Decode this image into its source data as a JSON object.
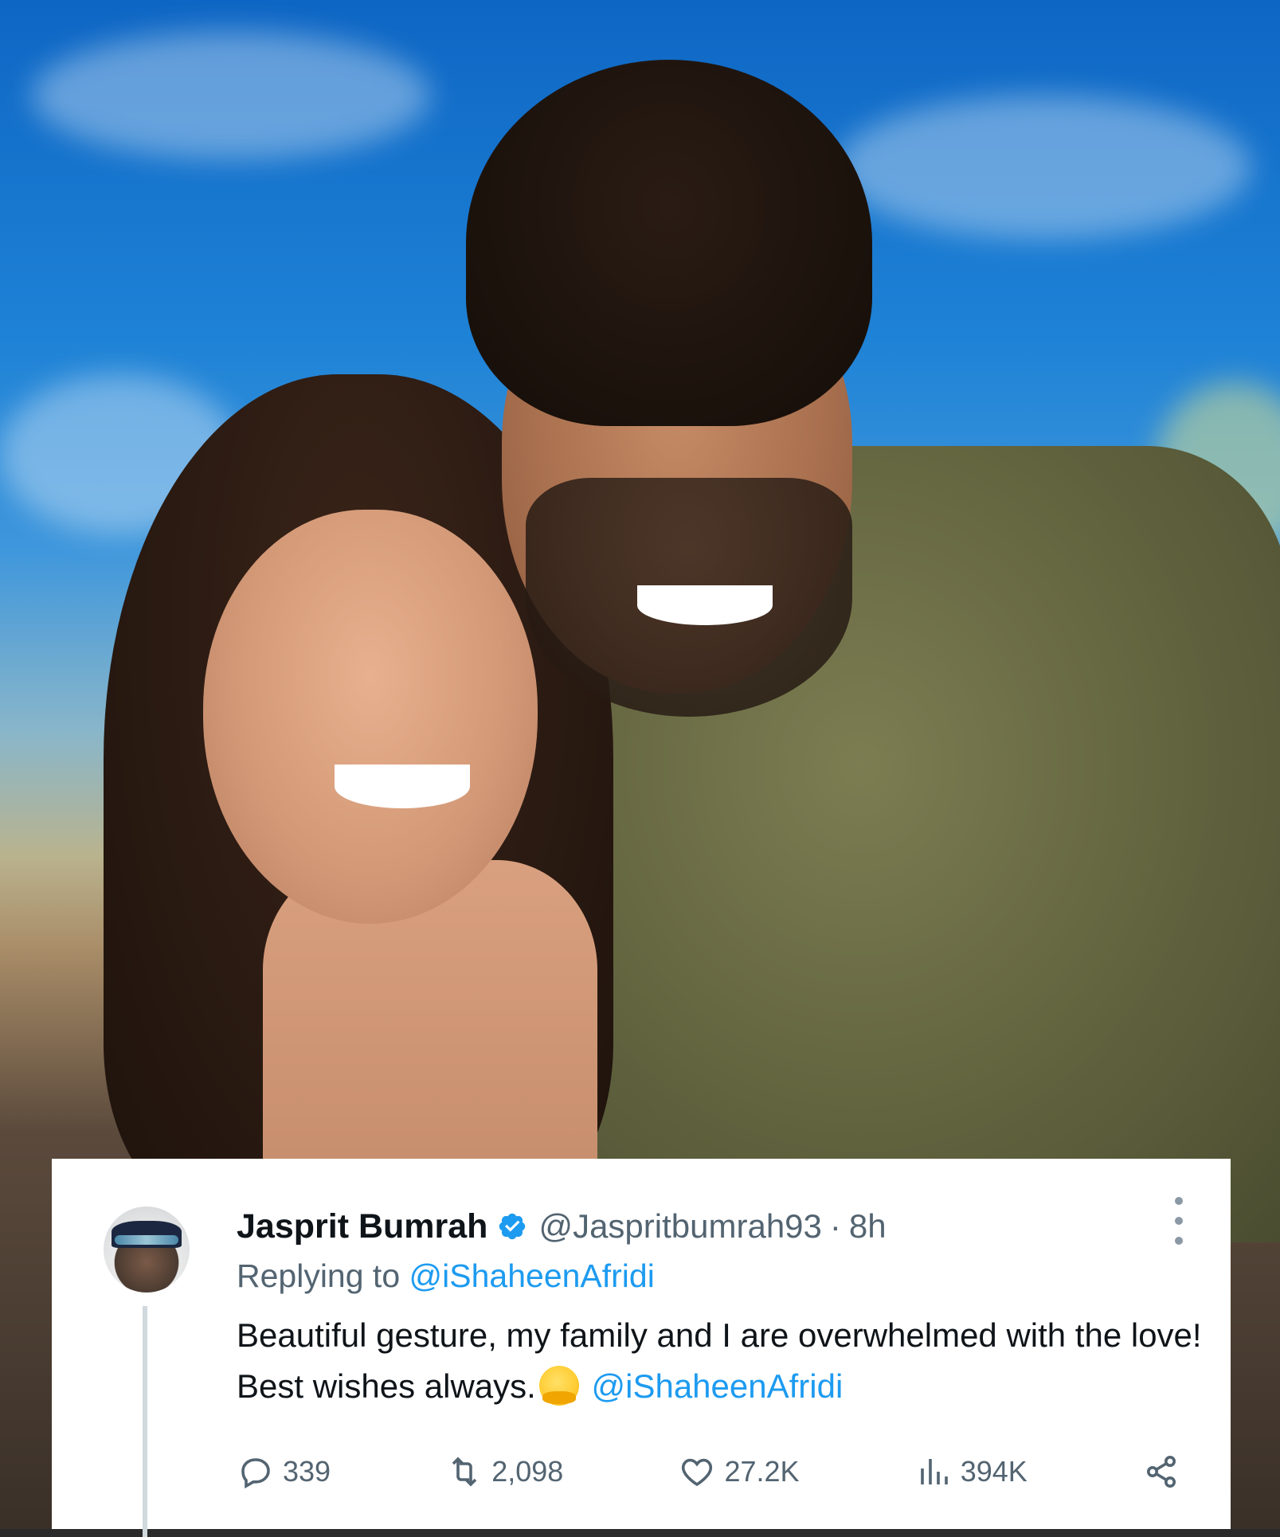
{
  "tweet": {
    "display_name": "Jasprit Bumrah",
    "handle": "@Jaspritbumrah93",
    "separator": "·",
    "time": "8h",
    "replying_prefix": "Replying to",
    "replying_to": "@iShaheenAfridi",
    "text_part1": "Beautiful gesture, my family and I are overwhelmed with the love! Best wishes always.",
    "emoji_name": "hugging-face-emoji",
    "text_mention": "@iShaheenAfridi",
    "stats": {
      "replies": "339",
      "reposts": "2,098",
      "likes": "27.2K",
      "views": "394K"
    }
  },
  "colors": {
    "link": "#1d9bf0",
    "secondary_text": "#536471",
    "primary_text": "#0f1419",
    "verified": "#1d9bf0"
  },
  "icons": [
    "verified-badge-icon",
    "more-options-icon",
    "reply-icon",
    "repost-icon",
    "like-icon",
    "views-icon",
    "share-icon"
  ]
}
